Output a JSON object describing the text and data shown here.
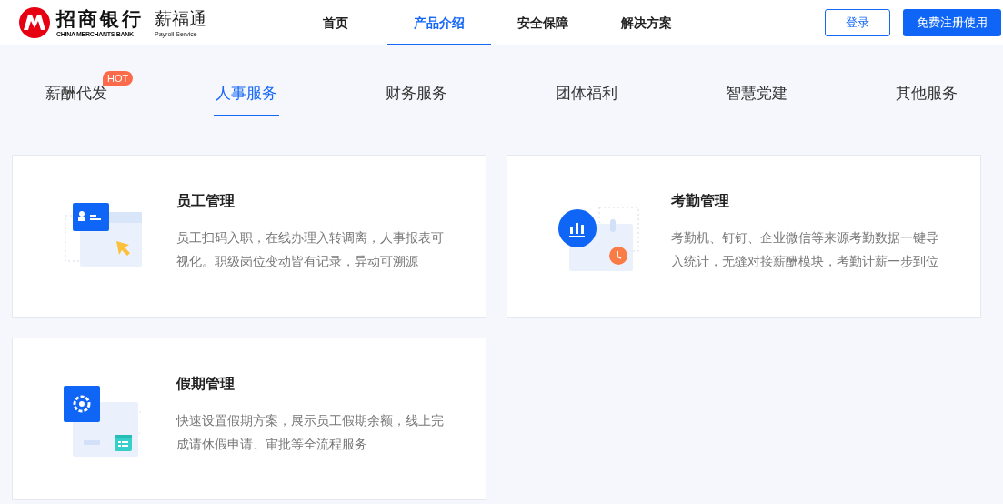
{
  "logo": {
    "bank_name": "招商银行",
    "bank_name_en": "CHINA MERCHANTS BANK",
    "product": "薪福通",
    "product_en": "Payroll Service"
  },
  "nav": [
    {
      "label": "首页",
      "selected": false
    },
    {
      "label": "产品介绍",
      "selected": true
    },
    {
      "label": "安全保障",
      "selected": false
    },
    {
      "label": "解决方案",
      "selected": false
    }
  ],
  "actions": {
    "login": "登录",
    "register": "免费注册使用"
  },
  "tabs": [
    {
      "label": "薪酬代发",
      "selected": false,
      "badge": "HOT"
    },
    {
      "label": "人事服务",
      "selected": true
    },
    {
      "label": "财务服务",
      "selected": false
    },
    {
      "label": "团体福利",
      "selected": false
    },
    {
      "label": "智慧党建",
      "selected": false
    },
    {
      "label": "其他服务",
      "selected": false
    }
  ],
  "cards": [
    {
      "kind": "idcard",
      "title": "员工管理",
      "description": "员工扫码入职，在线办理入转调离，人事报表可视化。职级岗位变动皆有记录，异动可溯源"
    },
    {
      "kind": "chart",
      "title": "考勤管理",
      "description": "考勤机、钉钉、企业微信等来源考勤数据一键导入统计，无缝对接薪酬模块，考勤计薪一步到位"
    },
    {
      "kind": "gear",
      "title": "假期管理",
      "description": "快速设置假期方案，展示员工假期余额，线上完成请休假申请、审批等全流程服务"
    }
  ]
}
